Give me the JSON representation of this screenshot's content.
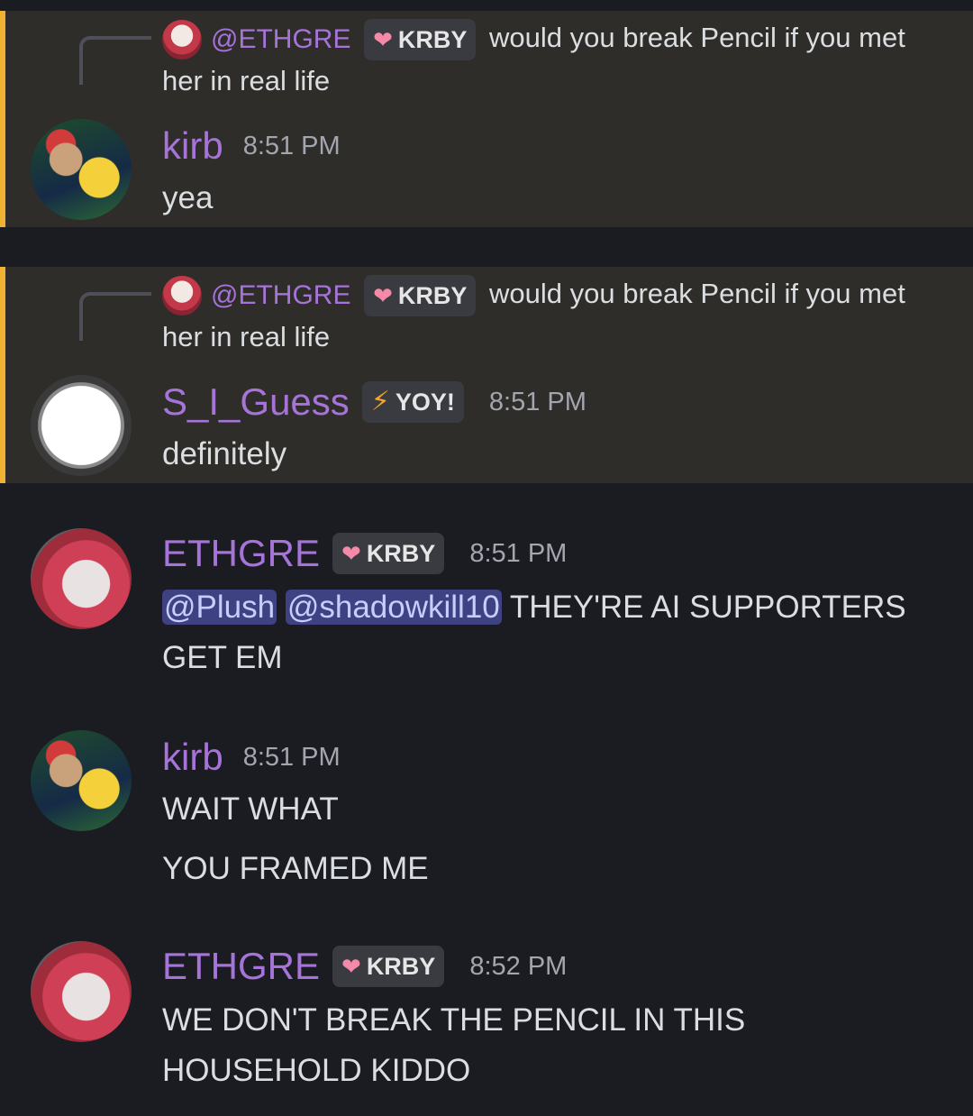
{
  "messages": [
    {
      "reply": {
        "name": "@ETHGRE",
        "tag": "KRBY",
        "text": "would you break Pencil if you met her in real life"
      },
      "author": "kirb",
      "time": "8:51 PM",
      "lines": [
        "yea"
      ]
    },
    {
      "reply": {
        "name": "@ETHGRE",
        "tag": "KRBY",
        "text": "would you break Pencil if you met her in real life"
      },
      "author": "S_I_Guess",
      "tag": "YOY!",
      "time": "8:51 PM",
      "lines": [
        "definitely"
      ]
    },
    {
      "author": "ETHGRE",
      "tag": "KRBY",
      "time": "8:51 PM",
      "mentions": [
        "@Plush",
        "@shadowkill10"
      ],
      "lines": [
        "THEY'RE AI SUPPORTERS",
        "GET EM"
      ]
    },
    {
      "author": "kirb",
      "time": "8:51 PM",
      "lines": [
        "WAIT WHAT",
        "YOU FRAMED ME"
      ]
    },
    {
      "author": "ETHGRE",
      "tag": "KRBY",
      "time": "8:52 PM",
      "lines": [
        "WE DON'T BREAK THE PENCIL IN THIS",
        "HOUSEHOLD KIDDO"
      ]
    }
  ]
}
